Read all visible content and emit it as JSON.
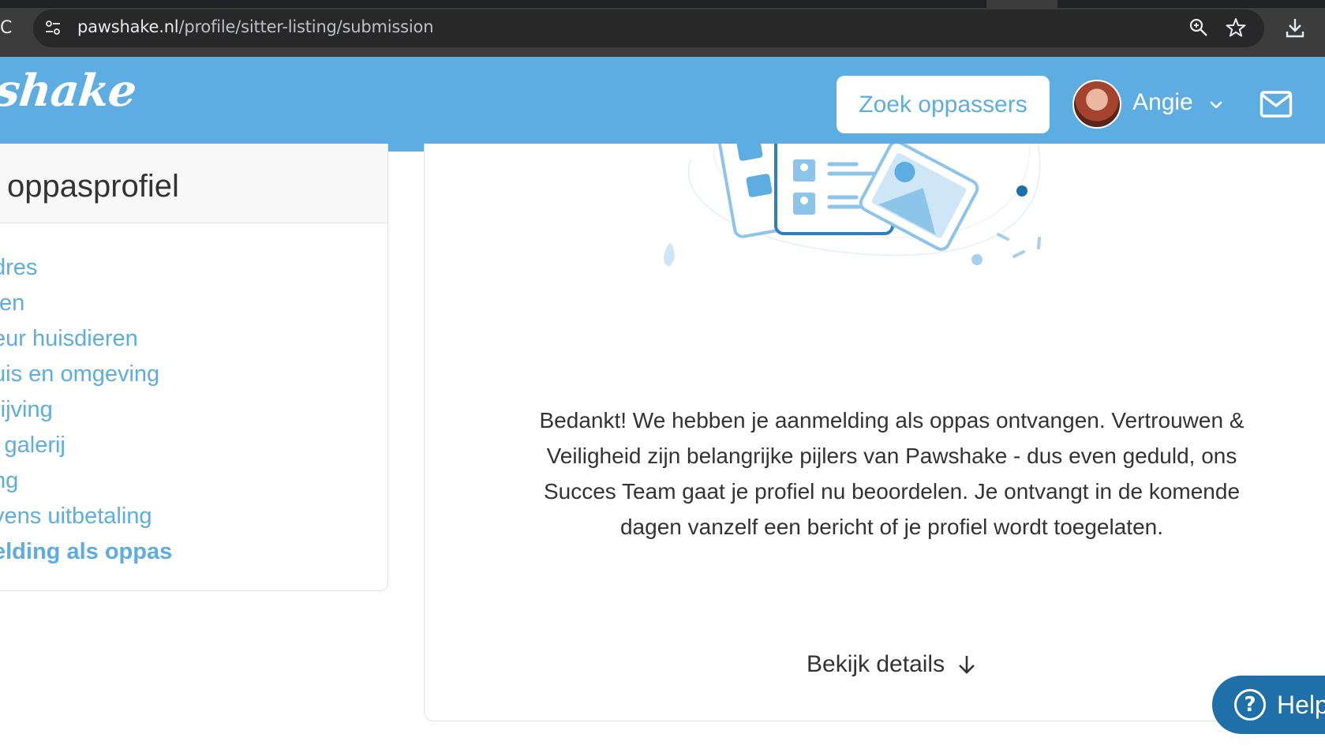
{
  "browser": {
    "reload_glyph": "C",
    "url_host": "pawshake.nl",
    "url_path": "/profile/sitter-listing/submission"
  },
  "header": {
    "logo_text": "shake",
    "search_button_label": "Zoek oppassers",
    "user_name": "Angie",
    "brand_color": "#5dade2"
  },
  "sidebar": {
    "title": "oppasprofiel",
    "items": [
      {
        "label": "dres"
      },
      {
        "label": "ten"
      },
      {
        "label": "eur huisdieren"
      },
      {
        "label": "uis en omgeving"
      },
      {
        "label": "rijving"
      },
      {
        "label": "l galerij"
      },
      {
        "label": "ng"
      },
      {
        "label": "vens uitbetaling"
      },
      {
        "label": "elding als oppas"
      }
    ],
    "active_index": 8
  },
  "main": {
    "confirmation_text": "Bedankt! We hebben je aanmelding als oppas ontvangen. Vertrouwen & Veiligheid zijn belangrijke pijlers van Pawshake - dus even geduld, ons Succes Team gaat je profiel nu beoordelen. Je ontvangt in de komende dagen vanzelf een bericht of je profiel wordt toegelaten.",
    "details_link_label": "Bekijk details"
  },
  "help": {
    "label": "Help",
    "icon_glyph": "?",
    "color": "#1f6fa8"
  }
}
